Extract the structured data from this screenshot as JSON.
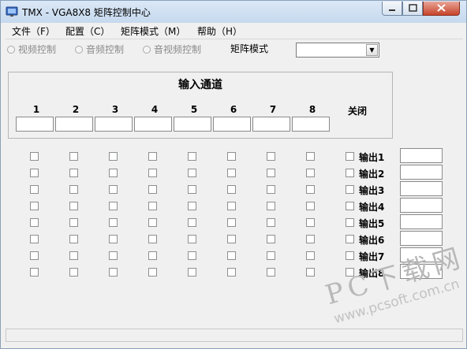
{
  "window": {
    "title": "TMX - VGA8X8 矩阵控制中心"
  },
  "menu": [
    "文件（F）",
    "配置（C）",
    "矩阵模式（M）",
    "帮助（H）"
  ],
  "modes": [
    "视频控制",
    "音频控制",
    "音视频控制"
  ],
  "matrix_mode": {
    "label": "矩阵模式",
    "value": ""
  },
  "input_group": {
    "title": "输入通道",
    "channels": [
      "1",
      "2",
      "3",
      "4",
      "5",
      "6",
      "7",
      "8"
    ],
    "close_label": "关闭"
  },
  "outputs": [
    "输出1",
    "输出2",
    "输出3",
    "输出4",
    "输出5",
    "输出6",
    "输出7",
    "输出8"
  ],
  "watermark": {
    "main": "PC下载网",
    "url": "www.pcsoft.com.cn"
  },
  "colors": {
    "titlebar": "#c6d9ee",
    "close_button": "#c7442a",
    "window_bg": "#f0f0f0"
  }
}
